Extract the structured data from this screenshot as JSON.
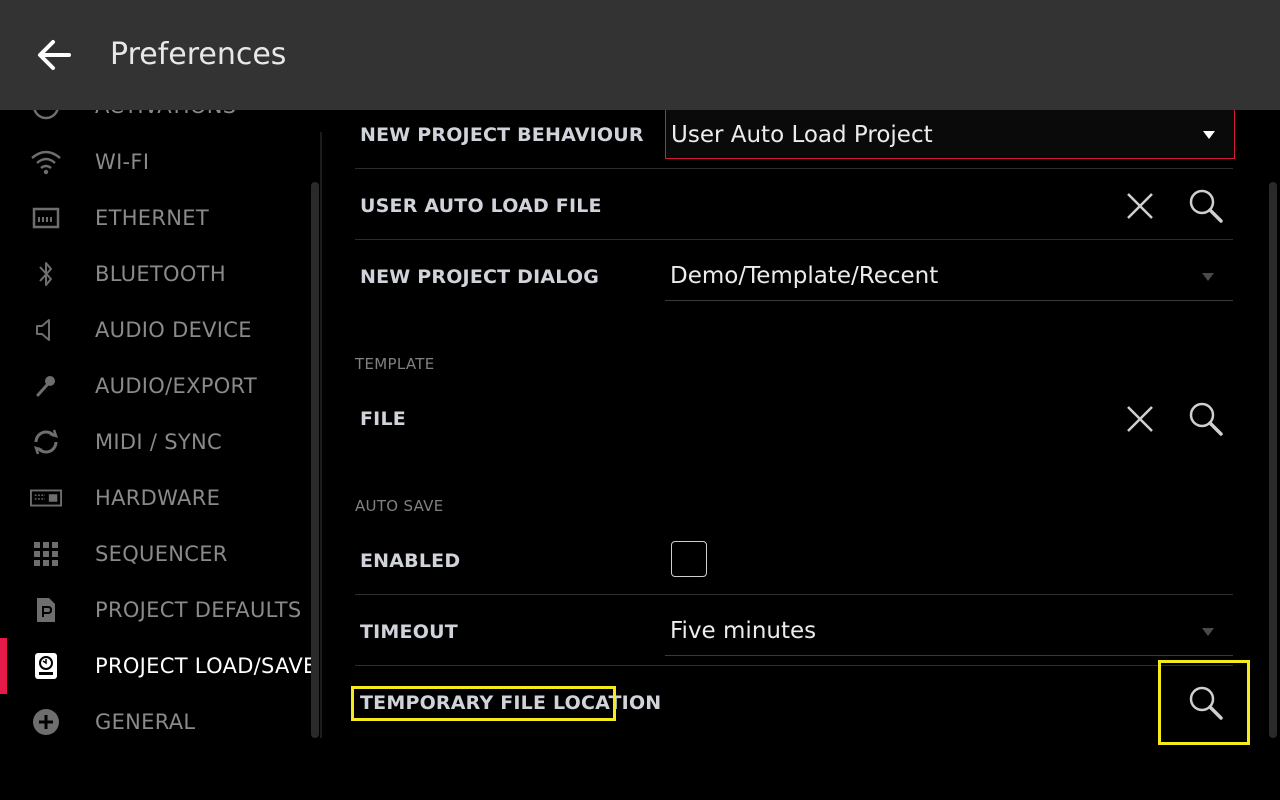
{
  "header": {
    "title": "Preferences"
  },
  "sidebar": {
    "items": [
      {
        "label": "ACTIVATIONS",
        "icon": "activations-icon"
      },
      {
        "label": "WI-FI",
        "icon": "wifi-icon"
      },
      {
        "label": "ETHERNET",
        "icon": "ethernet-icon"
      },
      {
        "label": "BLUETOOTH",
        "icon": "bluetooth-icon"
      },
      {
        "label": "AUDIO DEVICE",
        "icon": "speaker-icon"
      },
      {
        "label": "AUDIO/EXPORT",
        "icon": "microphone-icon"
      },
      {
        "label": "MIDI / SYNC",
        "icon": "sync-icon"
      },
      {
        "label": "HARDWARE",
        "icon": "hardware-icon"
      },
      {
        "label": "SEQUENCER",
        "icon": "grid-icon"
      },
      {
        "label": "PROJECT DEFAULTS",
        "icon": "document-icon"
      },
      {
        "label": "PROJECT LOAD/SAVE",
        "icon": "disk-icon",
        "active": true
      },
      {
        "label": "GENERAL",
        "icon": "plus-circle-icon"
      }
    ]
  },
  "main": {
    "new_project_behaviour": {
      "label": "NEW PROJECT BEHAVIOUR",
      "value": "User Auto Load Project"
    },
    "user_auto_load_file": {
      "label": "USER AUTO LOAD FILE"
    },
    "new_project_dialog": {
      "label": "NEW PROJECT DIALOG",
      "value": "Demo/Template/Recent"
    },
    "template": {
      "section_title": "TEMPLATE",
      "file_label": "FILE"
    },
    "auto_save": {
      "section_title": "AUTO SAVE",
      "enabled_label": "ENABLED",
      "enabled": false,
      "timeout_label": "TIMEOUT",
      "timeout_value": "Five minutes"
    },
    "temporary_file_location": {
      "label": "TEMPORARY FILE LOCATION"
    }
  },
  "colors": {
    "accent": "#e5194a",
    "highlight": "#f7ea1a",
    "header_bg": "#333333",
    "background": "#000000"
  }
}
